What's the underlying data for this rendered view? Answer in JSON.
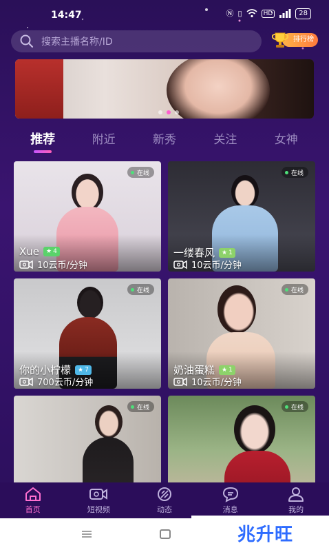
{
  "status_bar": {
    "time": "14:47",
    "battery": "28",
    "network": "HD"
  },
  "search": {
    "placeholder": "搜索主播名称/ID"
  },
  "ranking": {
    "label": "排行榜"
  },
  "banner": {
    "dots": 3,
    "active_dot": 2
  },
  "tabs": [
    {
      "label": "推荐",
      "active": true
    },
    {
      "label": "附近",
      "active": false
    },
    {
      "label": "新秀",
      "active": false
    },
    {
      "label": "关注",
      "active": false
    },
    {
      "label": "女神",
      "active": false
    }
  ],
  "cards": [
    {
      "name": "Xue",
      "level": "4",
      "level_color": "#5ad36a",
      "price": "10云币/分钟",
      "status": "在线"
    },
    {
      "name": "一缕春风",
      "level": "1",
      "level_color": "#8dd26a",
      "price": "10云币/分钟",
      "status": "在线"
    },
    {
      "name": "你的小柠檬",
      "level": "7",
      "level_color": "#4fb8e8",
      "price": "700云币/分钟",
      "status": "在线"
    },
    {
      "name": "奶油蛋糕",
      "level": "1",
      "level_color": "#8dd26a",
      "price": "10云币/分钟",
      "status": "在线"
    },
    {
      "name": "",
      "level": "",
      "level_color": "",
      "price": "",
      "status": "在线"
    },
    {
      "name": "",
      "level": "",
      "level_color": "",
      "price": "",
      "status": "在线"
    }
  ],
  "bottom_nav": [
    {
      "label": "首页",
      "icon": "home-icon",
      "active": true
    },
    {
      "label": "短视频",
      "icon": "video-icon",
      "active": false
    },
    {
      "label": "动态",
      "icon": "moments-icon",
      "active": false
    },
    {
      "label": "消息",
      "icon": "message-icon",
      "active": false
    },
    {
      "label": "我的",
      "icon": "profile-icon",
      "active": false
    }
  ],
  "watermark": "兆升旺",
  "colors": {
    "accent": "#ff6fd1",
    "background": "#2a1058",
    "online_dot": "#4ee07a"
  }
}
